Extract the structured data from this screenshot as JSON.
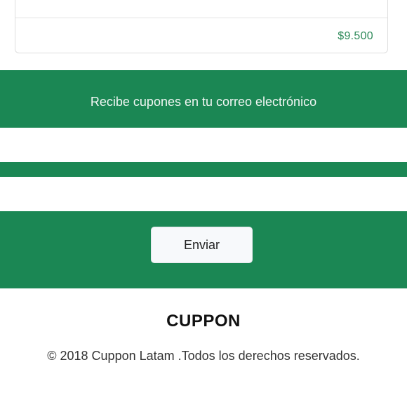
{
  "product_card": {
    "price": "$9.500"
  },
  "newsletter": {
    "title": "Recibe cupones en tu correo electrónico",
    "email_value": "",
    "name_value": "",
    "submit_label": "Enviar"
  },
  "footer": {
    "brand": "CUPPON",
    "copyright": "© 2018 Cuppon Latam .Todos los derechos reservados."
  },
  "colors": {
    "brand_green": "#1b8754",
    "price_green": "#2f8a5a"
  }
}
